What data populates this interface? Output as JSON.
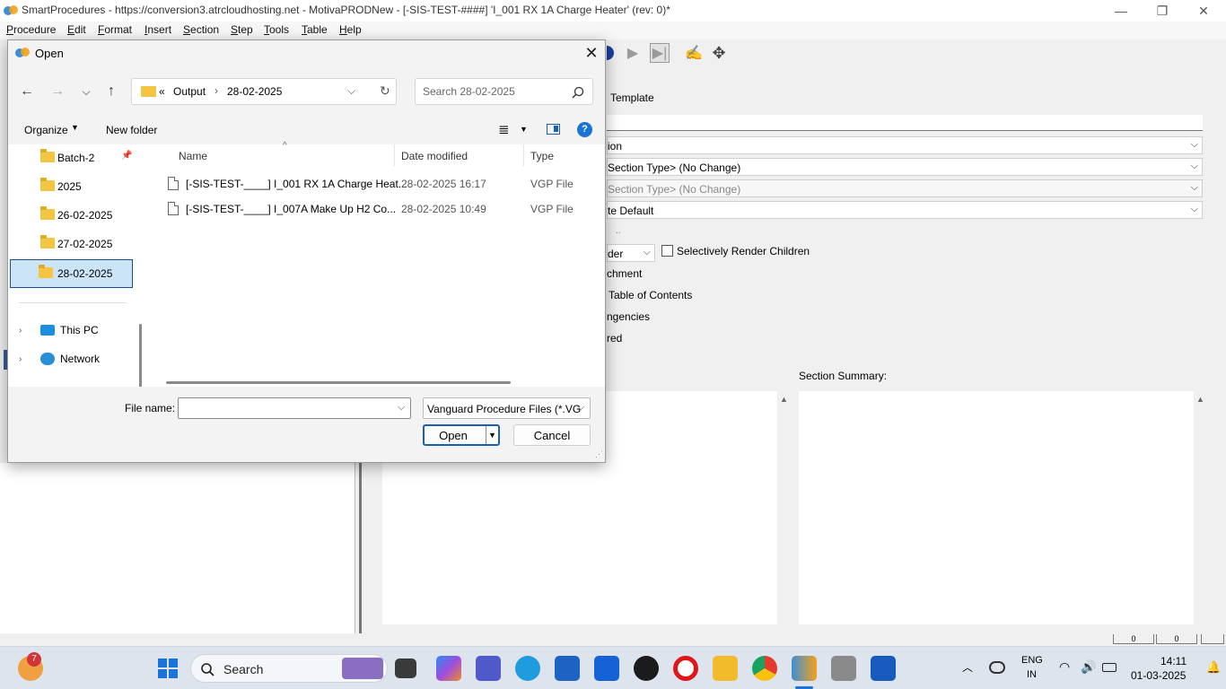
{
  "app": {
    "title": "SmartProcedures - https://conversion3.atrcloudhosting.net - MotivaPRODNew - [-SIS-TEST-####] 'I_001 RX 1A Charge Heater' (rev: 0)*",
    "menu": [
      "Procedure",
      "Edit",
      "Format",
      "Insert",
      "Section",
      "Step",
      "Tools",
      "Table",
      "Help"
    ],
    "window_controls": {
      "minimize": "—",
      "restore": "❐",
      "close": "✕"
    },
    "properties": {
      "tab": "Template",
      "row2": "ion",
      "row3": "Section Type> (No Change)",
      "row4": "Section Type> (No Change)",
      "row5": "te Default",
      "row6_small": "..",
      "render_partial": "der",
      "selectively_render_children": "Selectively Render Children",
      "attachment_partial": "chment",
      "toc_partial": "Table of Contents",
      "contingencies_partial": "ngencies",
      "red_partial": "red"
    },
    "section_summary_label": "Section Summary:",
    "status_boxes": [
      "0",
      "0"
    ]
  },
  "dialog": {
    "title": "Open",
    "close_icon": "✕",
    "address": {
      "chevron": "«",
      "crumbs": [
        "Output",
        "28-02-2025"
      ]
    },
    "search_placeholder": "Search 28-02-2025",
    "organize_label": "Organize",
    "new_folder_label": "New folder",
    "nav_items": [
      {
        "label": "Batch-2",
        "pinned": true
      },
      {
        "label": "2025"
      },
      {
        "label": "26-02-2025"
      },
      {
        "label": "27-02-2025"
      },
      {
        "label": "28-02-2025",
        "selected": true
      },
      {
        "label": "This PC"
      },
      {
        "label": "Network"
      }
    ],
    "columns": [
      "Name",
      "Date modified",
      "Type"
    ],
    "files": [
      {
        "name": "[-SIS-TEST-____] I_001 RX 1A Charge Heat...",
        "date": "28-02-2025 16:17",
        "type": "VGP File"
      },
      {
        "name": "[-SIS-TEST-____] I_007A Make Up H2 Co...",
        "date": "28-02-2025 10:49",
        "type": "VGP File"
      }
    ],
    "file_name_label": "File name:",
    "file_name_value": "",
    "file_type_value": "Vanguard Procedure Files (*.VG",
    "open_label": "Open",
    "cancel_label": "Cancel"
  },
  "taskbar": {
    "search_label": "Search",
    "notification_badge": "7",
    "language": "ENG",
    "region": "IN",
    "time": "14:11",
    "date": "01-03-2025"
  }
}
